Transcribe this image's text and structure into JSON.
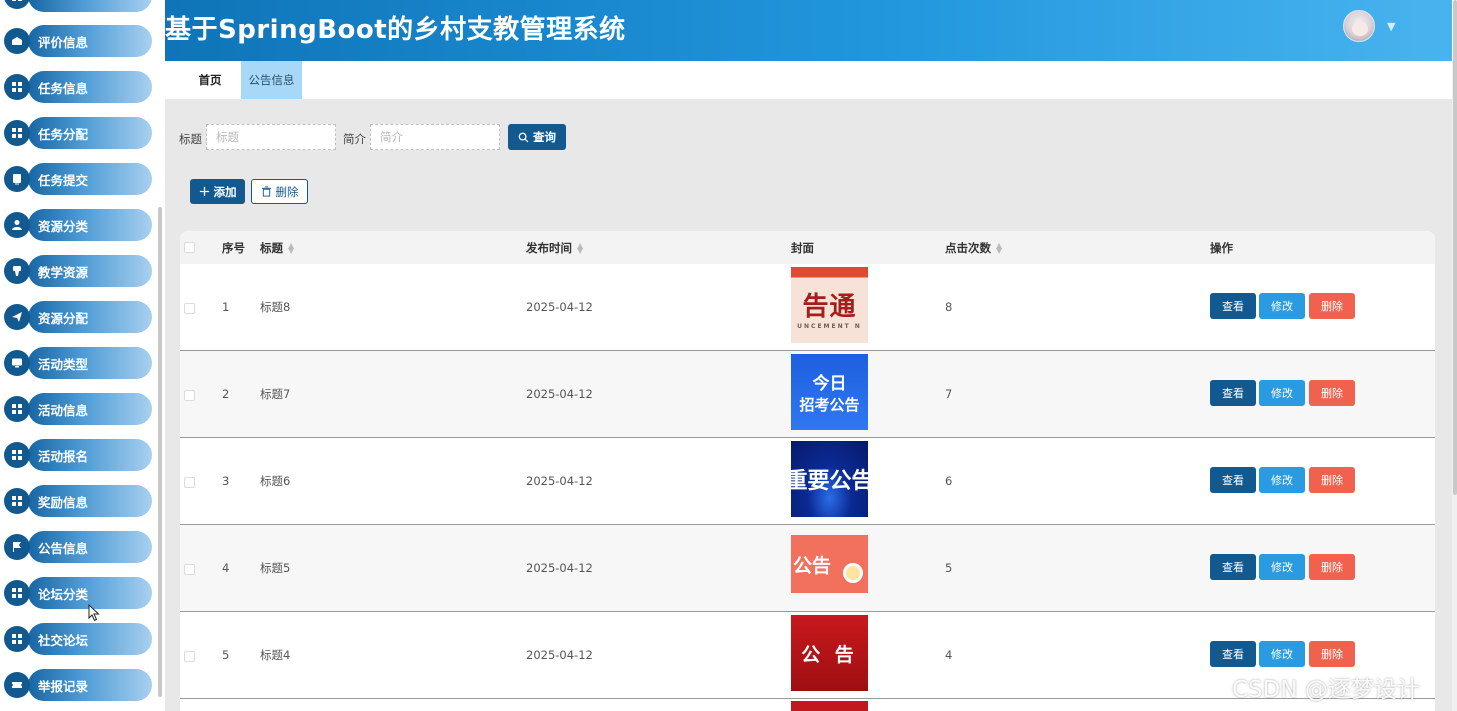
{
  "app": {
    "title": "基于SpringBoot的乡村支教管理系统"
  },
  "sidebar": {
    "items": [
      {
        "label": "评价信息",
        "icon": "comment-icon"
      },
      {
        "label": "任务信息",
        "icon": "grid-icon"
      },
      {
        "label": "任务分配",
        "icon": "grid-icon"
      },
      {
        "label": "任务提交",
        "icon": "tablet-icon"
      },
      {
        "label": "资源分类",
        "icon": "user-icon"
      },
      {
        "label": "教学资源",
        "icon": "medal-icon"
      },
      {
        "label": "资源分配",
        "icon": "send-icon"
      },
      {
        "label": "活动类型",
        "icon": "monitor-icon"
      },
      {
        "label": "活动信息",
        "icon": "grid-icon"
      },
      {
        "label": "活动报名",
        "icon": "grid-icon"
      },
      {
        "label": "奖励信息",
        "icon": "grid-icon"
      },
      {
        "label": "公告信息",
        "icon": "flag-icon"
      },
      {
        "label": "论坛分类",
        "icon": "grid-icon"
      },
      {
        "label": "社交论坛",
        "icon": "grid-icon"
      },
      {
        "label": "举报记录",
        "icon": "ticket-icon"
      }
    ]
  },
  "tabs": [
    {
      "label": "首页"
    },
    {
      "label": "公告信息"
    }
  ],
  "search": {
    "title_label": "标题",
    "title_placeholder": "标题",
    "intro_label": "简介",
    "intro_placeholder": "简介",
    "button_label": "查询"
  },
  "actions": {
    "add_label": "添加",
    "delete_label": "删除"
  },
  "table": {
    "columns": {
      "index": "序号",
      "title": "标题",
      "time": "发布时间",
      "cover": "封面",
      "clicks": "点击次数",
      "ops": "操作"
    },
    "row_actions": {
      "view": "查看",
      "edit": "修改",
      "delete": "删除"
    },
    "rows": [
      {
        "index": "1",
        "title": "标题8",
        "time": "2025-04-12",
        "clicks": "8",
        "cover_text": "告通",
        "cover_sub": "UNCEMENT N"
      },
      {
        "index": "2",
        "title": "标题7",
        "time": "2025-04-12",
        "clicks": "7",
        "cover_text": "今日",
        "cover_sub": "招考公告"
      },
      {
        "index": "3",
        "title": "标题6",
        "time": "2025-04-12",
        "clicks": "6",
        "cover_text": "重要公告",
        "cover_sub": ""
      },
      {
        "index": "4",
        "title": "标题5",
        "time": "2025-04-12",
        "clicks": "5",
        "cover_text": "公告",
        "cover_sub": ""
      },
      {
        "index": "5",
        "title": "标题4",
        "time": "2025-04-12",
        "clicks": "4",
        "cover_text": "公 告",
        "cover_sub": ""
      }
    ]
  },
  "watermark": "CSDN @逐梦设计"
}
